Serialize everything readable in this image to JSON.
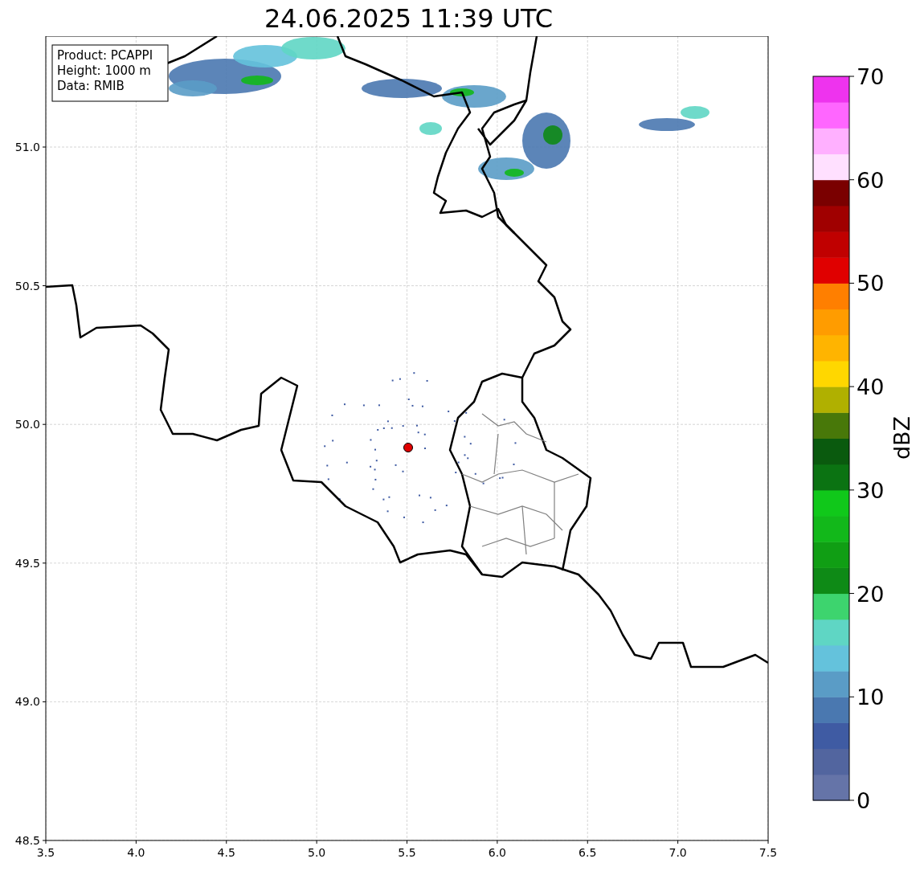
{
  "title": "24.06.2025 11:39 UTC",
  "info_box": [
    "Product: PCAPPI",
    "Height: 1000 m",
    "Data: RMIB"
  ],
  "x_ticks": [
    "3.5",
    "4.0",
    "4.5",
    "5.0",
    "5.5",
    "6.0",
    "6.5",
    "7.0",
    "7.5"
  ],
  "y_ticks": [
    "51.0",
    "50.5",
    "50.0",
    "49.5",
    "49.0",
    "48.5"
  ],
  "colorbar": {
    "label": "dBZ",
    "ticks": [
      "70",
      "60",
      "50",
      "40",
      "30",
      "20",
      "10",
      "0"
    ],
    "segments": [
      {
        "color": "#6574a8"
      },
      {
        "color": "#52659f"
      },
      {
        "color": "#3f5ba3"
      },
      {
        "color": "#4a78b0"
      },
      {
        "color": "#5a9cc6"
      },
      {
        "color": "#64c2dc"
      },
      {
        "color": "#5fd6c4"
      },
      {
        "color": "#3dd46e"
      },
      {
        "color": "#0e8a16"
      },
      {
        "color": "#109e14"
      },
      {
        "color": "#12b81a"
      },
      {
        "color": "#10c81a"
      },
      {
        "color": "#0b7312"
      },
      {
        "color": "#0a5a0e"
      },
      {
        "color": "#487809"
      },
      {
        "color": "#b0b000"
      },
      {
        "color": "#ffd700"
      },
      {
        "color": "#ffb400"
      },
      {
        "color": "#ff9c00"
      },
      {
        "color": "#ff7f00"
      },
      {
        "color": "#e00000"
      },
      {
        "color": "#c00000"
      },
      {
        "color": "#a00000"
      },
      {
        "color": "#7a0000"
      },
      {
        "color": "#ffe0ff"
      },
      {
        "color": "#ffb0ff"
      },
      {
        "color": "#ff66ff"
      },
      {
        "color": "#ee33ee"
      }
    ]
  }
}
